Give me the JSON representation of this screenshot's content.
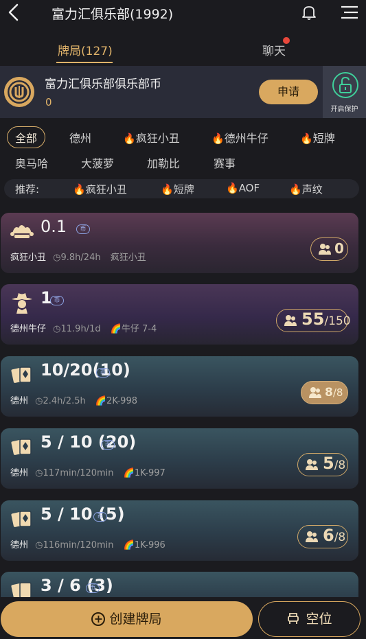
{
  "header": {
    "title": "富力汇俱乐部(1992)",
    "back_icon": "back-arrow-icon",
    "bell_icon": "bell-icon",
    "menu_icon": "menu-icon"
  },
  "tabs": [
    {
      "label": "牌局(127)",
      "active": true
    },
    {
      "label": "聊天",
      "has_dot": true
    }
  ],
  "coin_bar": {
    "name": "富力汇俱乐部俱乐部币",
    "balance": "0",
    "apply_label": "申请",
    "protect_label": "开启保护"
  },
  "filters": {
    "row1": [
      {
        "label": "全部",
        "active": true
      },
      {
        "label": "德州"
      },
      {
        "label": "疯狂小丑",
        "hot": true
      },
      {
        "label": "德州牛仔",
        "hot": true
      },
      {
        "label": "短牌",
        "hot": true
      }
    ],
    "row2": [
      {
        "label": "奥马哈"
      },
      {
        "label": "大菠萝"
      },
      {
        "label": "加勒比"
      },
      {
        "label": "赛事"
      }
    ],
    "flame_glyph": "🔥"
  },
  "recommend": {
    "label": "推荐:",
    "items": [
      "疯狂小丑",
      "短牌",
      "AOF",
      "声纹"
    ]
  },
  "games": [
    {
      "blinds": "0.1",
      "coin": "币",
      "type": "疯狂小丑",
      "time": "9.8h/24h",
      "tag": "疯狂小丑",
      "seats_count": "0",
      "seats_max": "",
      "icon": "jester-icon"
    },
    {
      "blinds": "1",
      "coin": "币",
      "type": "德州牛仔",
      "time": "11.9h/1d",
      "tag": "🌈牛仔 7-4",
      "seats_count": "55",
      "seats_max": "/150",
      "icon": "cowboy-icon"
    },
    {
      "blinds": "10/20(10)",
      "coin": "币",
      "type": "德州",
      "time": "2.4h/2.5h",
      "tag": "🌈2K-998",
      "seats_count": "8",
      "seats_max": "/8",
      "icon": "cards-icon",
      "full": true
    },
    {
      "blinds": "5 / 10 (20)",
      "coin": "币",
      "type": "德州",
      "time": "117min/120min",
      "tag": "🌈1K-997",
      "seats_count": "5",
      "seats_max": "/8",
      "icon": "cards-icon"
    },
    {
      "blinds": "5 / 10 (5)",
      "coin": "币",
      "type": "德州",
      "time": "116min/120min",
      "tag": "🌈1K-996",
      "seats_count": "6",
      "seats_max": "/8",
      "icon": "cards-icon"
    },
    {
      "blinds": "3 / 6 (3)",
      "coin": "币",
      "icon": "cards-icon"
    }
  ],
  "bottom": {
    "create_label": "创建牌局",
    "seat_label": "空位"
  }
}
